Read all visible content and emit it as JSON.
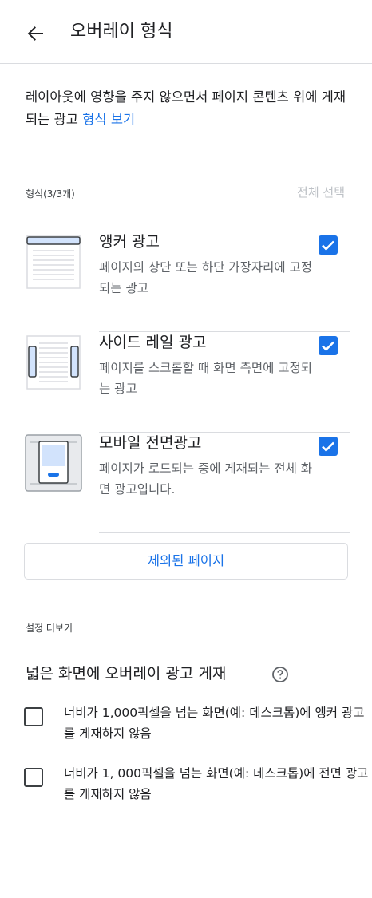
{
  "header": {
    "title": "오버레이 형식"
  },
  "intro": {
    "text": "레이아웃에 영향을 주지 않으면서 페이지 콘텐츠 위에 게재되는 광고 ",
    "link": "형식 보기"
  },
  "formats": {
    "label": "형식(3/3개)",
    "select_all": "전체 선택",
    "items": [
      {
        "title": "앵커 광고",
        "description": "페이지의 상단 또는 하단 가장자리에 고정되는 광고",
        "checked": true,
        "icon": "anchor-ad-icon"
      },
      {
        "title": "사이드 레일 광고",
        "description": "페이지를 스크롤할 때 화면 측면에 고정되는 광고",
        "checked": true,
        "icon": "side-rail-ad-icon"
      },
      {
        "title": "모바일 전면광고",
        "description": "페이지가 로드되는 중에 게재되는 전체 화면 광고입니다.",
        "checked": true,
        "icon": "mobile-vignette-ad-icon"
      }
    ]
  },
  "excluded_pages_button": "제외된 페이지",
  "more_settings": {
    "label": "설정 더보기"
  },
  "wide_screen": {
    "title": "넓은 화면에 오버레이 광고 게재",
    "options": [
      {
        "label": "너비가 1,000픽셀을 넘는 화면(예: 데스크톱)에 앵커 광고를 게재하지 않음",
        "checked": false
      },
      {
        "label": "너비가 1, 000픽셀을 넘는 화면(예: 데스크톱)에 전면 광고를 게재하지 않음",
        "checked": false
      }
    ]
  },
  "colors": {
    "accent": "#1a73e8",
    "divider": "#dadce0",
    "disabled_text": "#bdc1c6"
  }
}
